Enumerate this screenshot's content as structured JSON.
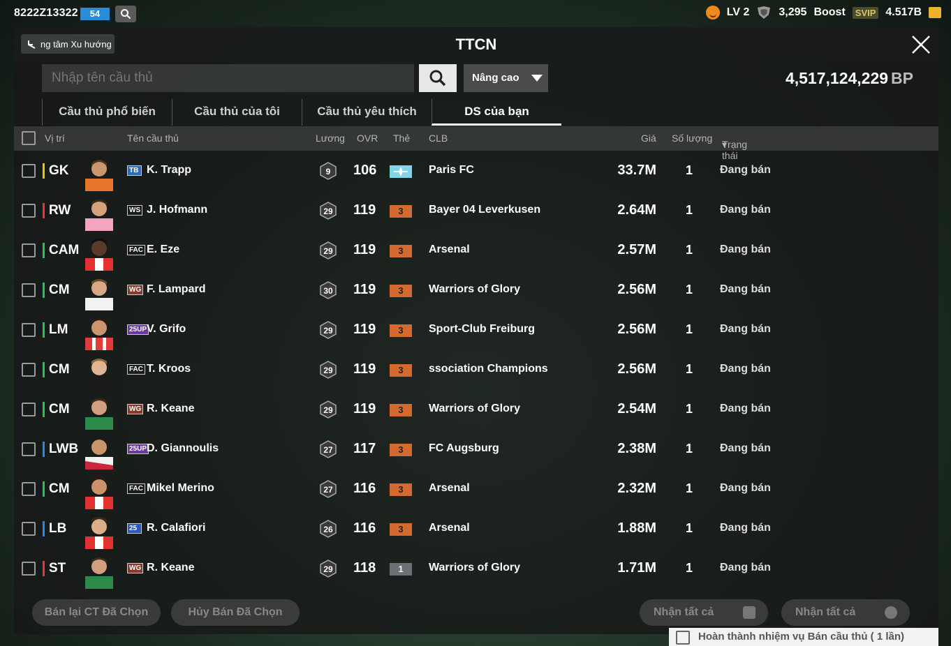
{
  "topbar": {
    "uid": "8222Z13322",
    "level_badge": "54",
    "lv": "LV 2",
    "shield_count": "3,295",
    "boost": "Boost",
    "svip": "SVIP",
    "coins": "4.517B"
  },
  "header": {
    "back_label": "ng tâm Xu hướng",
    "title": "TTCN"
  },
  "search": {
    "placeholder": "Nhập tên cầu thủ",
    "advanced_label": "Nâng cao"
  },
  "balance": {
    "value": "4,517,124,229",
    "unit": "BP"
  },
  "tabs": [
    {
      "label": "Cầu thủ phổ biến"
    },
    {
      "label": "Cầu thủ của tôi"
    },
    {
      "label": "Cầu thủ yêu thích"
    },
    {
      "label": "DS của bạn",
      "active": true
    }
  ],
  "columns": {
    "position": "Vị trí",
    "name": "Tên cầu thủ",
    "wage": "Lương",
    "ovr": "OVR",
    "card": "Thẻ",
    "club": "CLB",
    "price": "Giá",
    "qty": "Số lượng",
    "status": "Trạng thái"
  },
  "rows": [
    {
      "pos": "GK",
      "season": "TB",
      "name": "K. Trapp",
      "wage": "9",
      "ovr": "106",
      "grade": "",
      "club": "Paris FC",
      "price": "33.7M",
      "qty": "1",
      "status": "Đang bán"
    },
    {
      "pos": "RW",
      "season": "WS",
      "name": "J. Hofmann",
      "wage": "29",
      "ovr": "119",
      "grade": "3",
      "club": "Bayer 04 Leverkusen",
      "price": "2.64M",
      "qty": "1",
      "status": "Đang bán"
    },
    {
      "pos": "CAM",
      "season": "FAC",
      "name": "E. Eze",
      "wage": "29",
      "ovr": "119",
      "grade": "3",
      "club": "Arsenal",
      "price": "2.57M",
      "qty": "1",
      "status": "Đang bán"
    },
    {
      "pos": "CM",
      "season": "WG",
      "name": "F. Lampard",
      "wage": "30",
      "ovr": "119",
      "grade": "3",
      "club": "Warriors of Glory",
      "price": "2.56M",
      "qty": "1",
      "status": "Đang bán"
    },
    {
      "pos": "LM",
      "season": "25UP",
      "name": "V. Grifo",
      "wage": "29",
      "ovr": "119",
      "grade": "3",
      "club": "Sport-Club Freiburg",
      "price": "2.56M",
      "qty": "1",
      "status": "Đang bán"
    },
    {
      "pos": "CM",
      "season": "FAC",
      "name": "T. Kroos",
      "wage": "29",
      "ovr": "119",
      "grade": "3",
      "club": "ssociation Champions",
      "price": "2.56M",
      "qty": "1",
      "status": "Đang bán"
    },
    {
      "pos": "CM",
      "season": "WG",
      "name": "R. Keane",
      "wage": "29",
      "ovr": "119",
      "grade": "3",
      "club": "Warriors of Glory",
      "price": "2.54M",
      "qty": "1",
      "status": "Đang bán"
    },
    {
      "pos": "LWB",
      "season": "25UP",
      "name": "D. Giannoulis",
      "wage": "27",
      "ovr": "117",
      "grade": "3",
      "club": "FC Augsburg",
      "price": "2.38M",
      "qty": "1",
      "status": "Đang bán"
    },
    {
      "pos": "CM",
      "season": "FAC",
      "name": "Mikel Merino",
      "wage": "27",
      "ovr": "116",
      "grade": "3",
      "club": "Arsenal",
      "price": "2.32M",
      "qty": "1",
      "status": "Đang bán"
    },
    {
      "pos": "LB",
      "season": "25",
      "name": "R. Calafiori",
      "wage": "26",
      "ovr": "116",
      "grade": "3",
      "club": "Arsenal",
      "price": "1.88M",
      "qty": "1",
      "status": "Đang bán"
    },
    {
      "pos": "ST",
      "season": "WG",
      "name": "R. Keane",
      "wage": "29",
      "ovr": "118",
      "grade": "1",
      "club": "Warriors of Glory",
      "price": "1.71M",
      "qty": "1",
      "status": "Đang bán"
    }
  ],
  "footer": {
    "resell_label": "Bán lại CT Đã Chọn",
    "cancel_label": "Hủy Bán Đã Chọn",
    "collect_all_1": "Nhận tất cả",
    "collect_all_2": "Nhận tất cả"
  },
  "notice": {
    "text": "Hoàn thành nhiệm vụ Bán cầu thủ ( 1 lần)"
  },
  "colors": {
    "accent_gk": "#f2c200",
    "accent_mid": "#2ac05a",
    "accent_att": "#e8343a",
    "accent_def": "#2a8be0",
    "grade": "#d56a30"
  }
}
